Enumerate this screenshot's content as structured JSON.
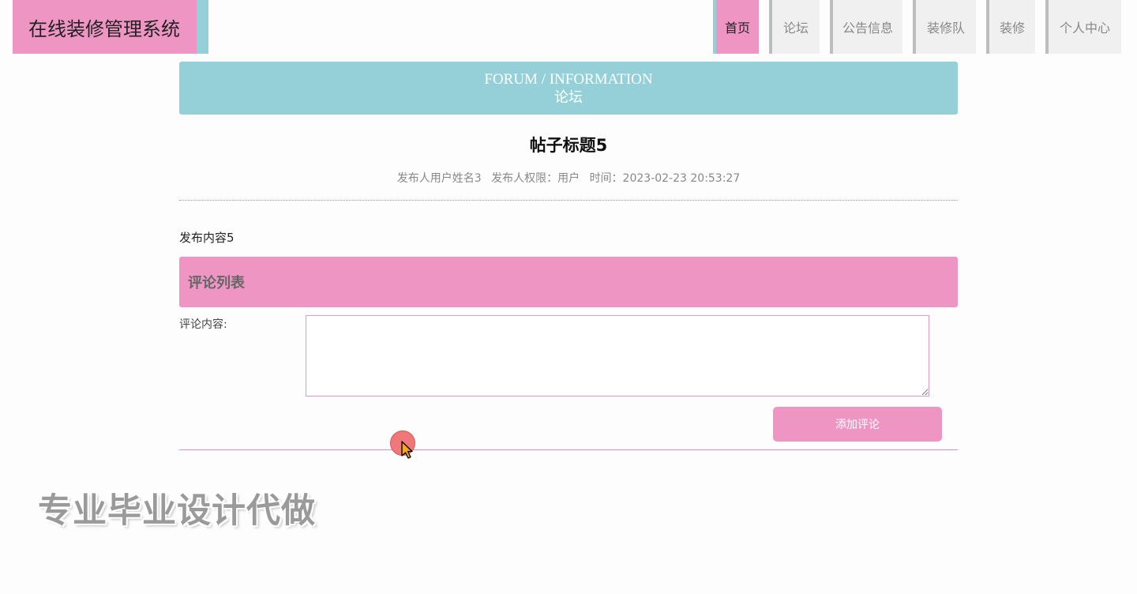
{
  "app": {
    "title": "在线装修管理系统"
  },
  "nav": {
    "items": [
      {
        "label": "首页",
        "active": true
      },
      {
        "label": "论坛",
        "active": false
      },
      {
        "label": "公告信息",
        "active": false
      },
      {
        "label": "装修队",
        "active": false
      },
      {
        "label": "装修",
        "active": false
      },
      {
        "label": "个人中心",
        "active": false
      }
    ]
  },
  "banner": {
    "english": "FORUM / INFORMATION",
    "chinese": "论坛"
  },
  "post": {
    "title": "帖子标题5",
    "author": "发布人用户姓名3",
    "role": "发布人权限：用户",
    "time": "时间：2023-02-23 20:53:27",
    "content": "发布内容5"
  },
  "comments": {
    "section_title": "评论列表",
    "input_label": "评论内容:",
    "input_value": "",
    "submit_label": "添加评论"
  },
  "overlay": {
    "watermark": "专业毕业设计代做"
  },
  "colors": {
    "accent_pink": "#ee95c4",
    "accent_teal": "#95d0d9"
  }
}
